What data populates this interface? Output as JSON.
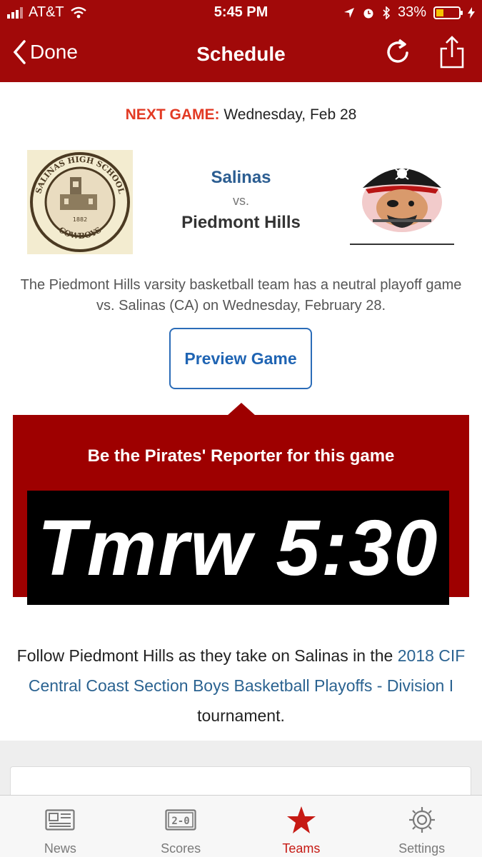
{
  "status_bar": {
    "carrier": "AT&T",
    "time": "5:45 PM",
    "battery": "33%"
  },
  "nav": {
    "back_label": "Done",
    "title": "Schedule"
  },
  "next_game": {
    "label": "NEXT GAME:",
    "date": "Wednesday, Feb 28"
  },
  "matchup": {
    "home": "Salinas",
    "vs": "vs.",
    "away": "Piedmont Hills"
  },
  "logos": {
    "home_ring_text": "SALINAS HIGH SCHOOL",
    "home_bottom_text": "COWBOYS",
    "home_year": "1882"
  },
  "description": "The Piedmont Hills varsity basketball team has a neutral playoff game vs. Salinas (CA) on Wednesday, February 28.",
  "preview_button": "Preview Game",
  "reporter": {
    "title": "Be the Pirates' Reporter for this game",
    "countdown": "Tmrw 5:30"
  },
  "follow": {
    "prefix": "Follow Piedmont Hills as they take on Salinas in the ",
    "link": "2018 CIF Central Coast Section Boys Basketball Playoffs - Division I",
    "suffix": " tournament."
  },
  "tabs": [
    {
      "label": "News",
      "icon": "newspaper-icon",
      "active": false
    },
    {
      "label": "Scores",
      "icon": "scoreboard-icon",
      "active": false
    },
    {
      "label": "Teams",
      "icon": "star-icon",
      "active": true
    },
    {
      "label": "Settings",
      "icon": "gear-icon",
      "active": false
    }
  ],
  "colors": {
    "brand_red": "#a10909",
    "accent_orange": "#e23a24",
    "link_blue": "#2b6391",
    "active_tab": "#c61a14"
  },
  "scoreboard_icon_text": "2-0"
}
